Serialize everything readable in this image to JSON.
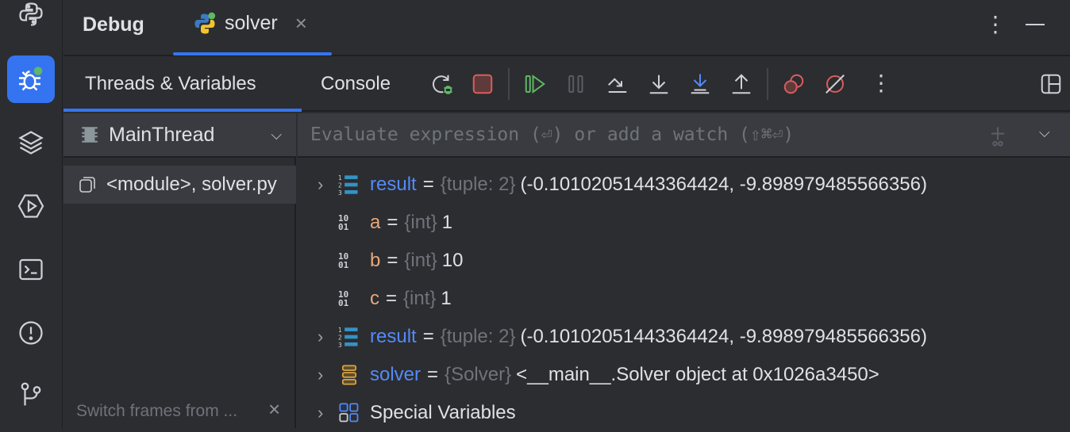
{
  "sidebar": {
    "items": [
      "python-console",
      "debug",
      "layers",
      "services",
      "terminal",
      "problems",
      "git"
    ]
  },
  "header": {
    "title": "Debug",
    "tab_label": "solver"
  },
  "subtabs": {
    "threads_vars": "Threads & Variables",
    "console": "Console"
  },
  "threads": {
    "selected": "MainThread",
    "frame": "<module>, solver.py",
    "hint": "Switch frames from ..."
  },
  "evaluate": {
    "placeholder": "Evaluate expression (⏎) or add a watch (⇧⌘⏎)"
  },
  "variables": [
    {
      "name": "result",
      "type": "{tuple: 2}",
      "value": "(-0.10102051443364424, -9.898979485566356)",
      "kind": "tuple",
      "expandable": true
    },
    {
      "name": "a",
      "type": "{int}",
      "value": "1",
      "kind": "int",
      "expandable": false
    },
    {
      "name": "b",
      "type": "{int}",
      "value": "10",
      "kind": "int",
      "expandable": false
    },
    {
      "name": "c",
      "type": "{int}",
      "value": "1",
      "kind": "int",
      "expandable": false
    },
    {
      "name": "result",
      "type": "{tuple: 2}",
      "value": "(-0.10102051443364424, -9.898979485566356)",
      "kind": "tuple",
      "expandable": true
    },
    {
      "name": "solver",
      "type": "{Solver}",
      "value": "<__main__.Solver object at 0x1026a3450>",
      "kind": "object",
      "expandable": true
    },
    {
      "name": "Special Variables",
      "type": "",
      "value": "",
      "kind": "special",
      "expandable": true
    }
  ],
  "int_icon": {
    "top": "10",
    "bottom": "01"
  },
  "colors": {
    "accent": "#3574f0",
    "green": "#5fb865",
    "red": "#db5c5c"
  }
}
